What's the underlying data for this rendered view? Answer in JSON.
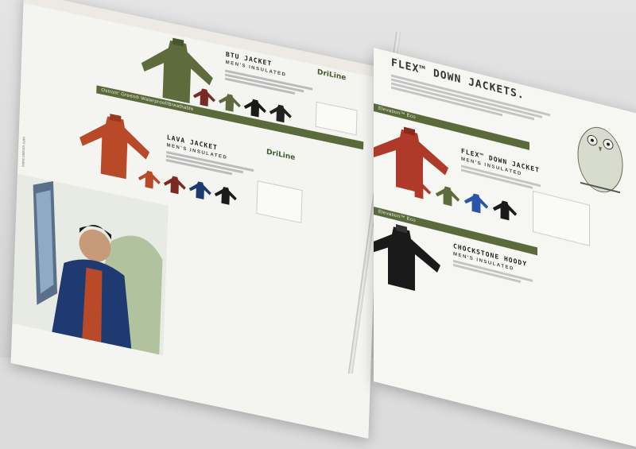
{
  "left_page": {
    "btu": {
      "title": "BTU JACKET",
      "sub": "MEN'S INSULATED"
    },
    "band_top": "Ostrom' Green® Waterproof/Breathable",
    "lava": {
      "title": "LAVA JACKET",
      "sub": "MEN'S INSULATED"
    },
    "logo": "DriLine",
    "side_text": "www.ostrom.com"
  },
  "right_page": {
    "header": "FLEX™ DOWN JACKETS.",
    "band_mid": "Elevation™ Eco",
    "flex": {
      "title": "FLEX™ DOWN JACKET",
      "sub": "MEN'S INSULATED"
    },
    "band_low": "Elevation™ Eco",
    "chock": {
      "title": "CHOCKSTONE HOODY",
      "sub": "MEN'S INSULATED"
    }
  },
  "colors": {
    "olive": "#5e6b3c",
    "rust": "#b84a2a",
    "navy": "#1f3a70",
    "blue": "#2a54a8",
    "black": "#1a1a1a",
    "darkred": "#7a2a22"
  }
}
